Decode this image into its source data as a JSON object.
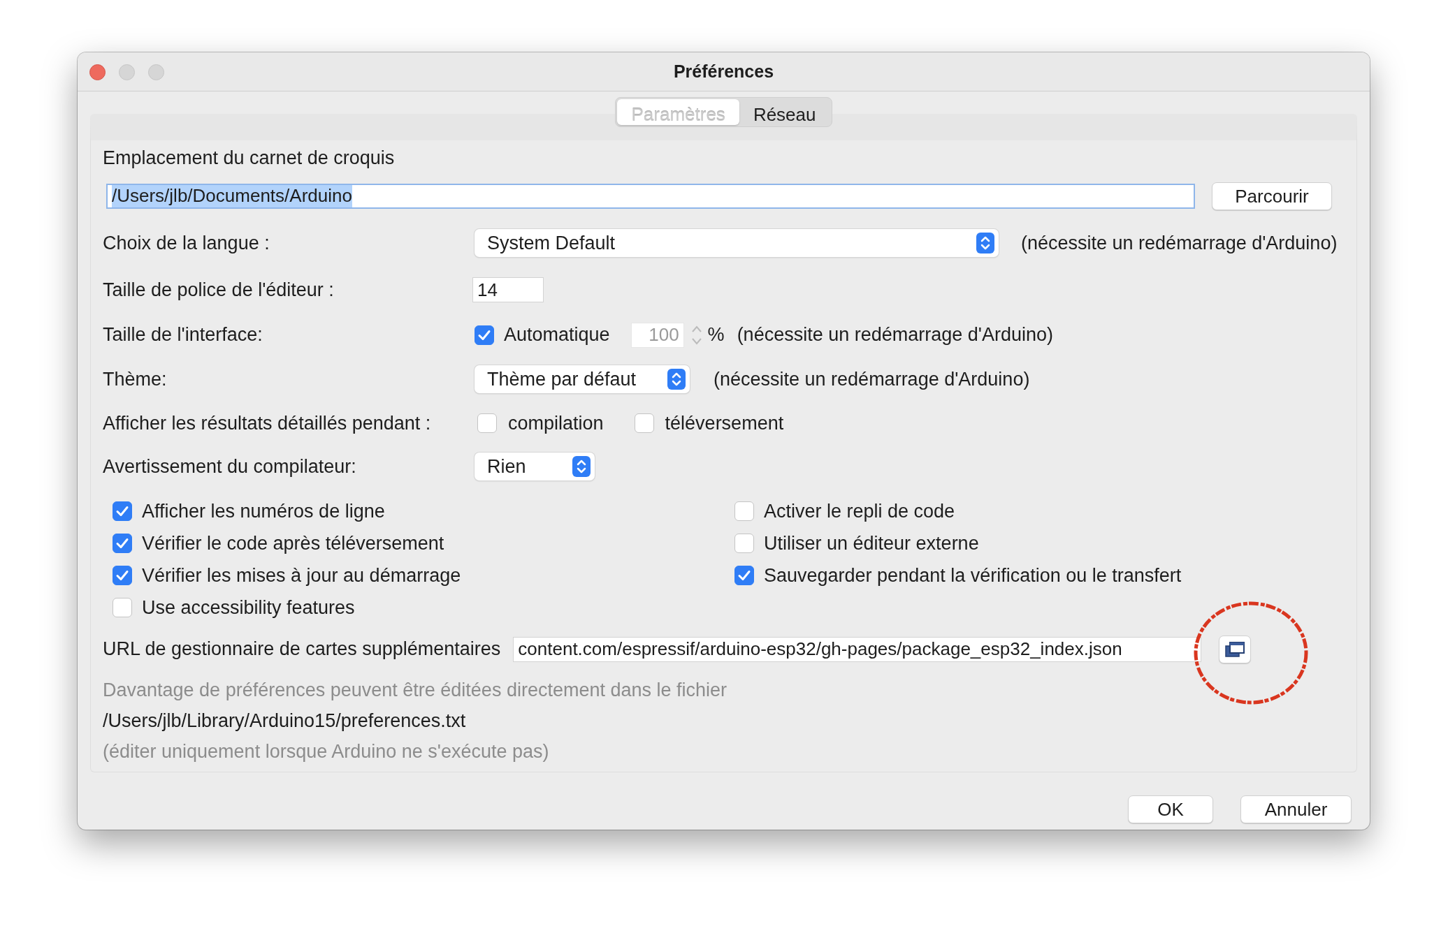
{
  "window": {
    "title": "Préférences"
  },
  "tabs": [
    {
      "label": "Paramètres",
      "selected": true
    },
    {
      "label": "Réseau",
      "selected": false
    }
  ],
  "sketchbook": {
    "label": "Emplacement du carnet de croquis",
    "value": "/Users/jlb/Documents/Arduino",
    "selected_text": true,
    "browse_button": "Parcourir"
  },
  "language": {
    "label": "Choix de la langue :",
    "value": "System Default",
    "note": "(nécessite un redémarrage d'Arduino)"
  },
  "editor_font_size": {
    "label": "Taille de police de l'éditeur :",
    "value": "14"
  },
  "interface_scale": {
    "label": "Taille de l'interface:",
    "automatic": {
      "label": "Automatique",
      "checked": true
    },
    "value": "100",
    "disabled": true,
    "unit": "%",
    "note": "(nécessite un redémarrage d'Arduino)"
  },
  "theme": {
    "label": "Thème:",
    "value": "Thème par défaut",
    "note": "(nécessite un redémarrage d'Arduino)"
  },
  "verbose": {
    "label": "Afficher les résultats détaillés pendant :",
    "options": [
      {
        "label": "compilation",
        "checked": false
      },
      {
        "label": "téléversement",
        "checked": false
      }
    ]
  },
  "compiler_warnings": {
    "label": "Avertissement du compilateur:",
    "value": "Rien"
  },
  "options": [
    {
      "label": "Afficher les numéros de ligne",
      "checked": true
    },
    {
      "label": "Activer le repli de code",
      "checked": false
    },
    {
      "label": "Vérifier le code après téléversement",
      "checked": true
    },
    {
      "label": "Utiliser un éditeur externe",
      "checked": false
    },
    {
      "label": "Vérifier les mises à jour au démarrage",
      "checked": true
    },
    {
      "label": "Sauvegarder pendant la vérification ou le transfert",
      "checked": true
    },
    {
      "label": "Use accessibility features",
      "checked": false
    }
  ],
  "board_urls": {
    "label": "URL de gestionnaire de cartes supplémentaires",
    "value": "content.com/espressif/arduino-esp32/gh-pages/package_esp32_index.json"
  },
  "info": [
    {
      "kind": "note",
      "text": "Davantage de préférences peuvent être éditées directement dans le fichier"
    },
    {
      "kind": "path",
      "text": "/Users/jlb/Library/Arduino15/preferences.txt"
    },
    {
      "kind": "note",
      "text": "(éditer uniquement lorsque Arduino ne s'exécute pas)"
    }
  ],
  "buttons": [
    "OK",
    "Annuler"
  ]
}
